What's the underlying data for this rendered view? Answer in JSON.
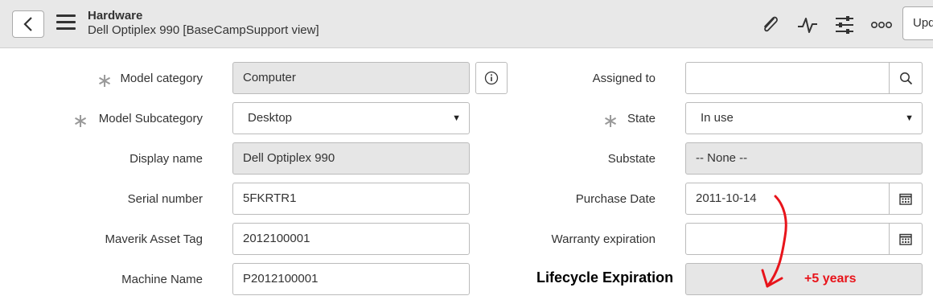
{
  "header": {
    "title": "Hardware",
    "subtitle": "Dell Optiplex 990 [BaseCampSupport view]",
    "update_label": "Upd"
  },
  "form": {
    "model_category": {
      "label": "Model category",
      "value": "Computer"
    },
    "model_subcategory": {
      "label": "Model Subcategory",
      "value": "Desktop"
    },
    "display_name": {
      "label": "Display name",
      "value": "Dell Optiplex 990"
    },
    "serial_number": {
      "label": "Serial number",
      "value": "5FKRTR1"
    },
    "asset_tag": {
      "label": "Maverik Asset Tag",
      "value": "2012100001"
    },
    "machine_name": {
      "label": "Machine Name",
      "value": "P2012100001"
    },
    "assigned_to": {
      "label": "Assigned to",
      "value": ""
    },
    "state": {
      "label": "State",
      "value": "In use"
    },
    "substate": {
      "label": "Substate",
      "value": "-- None --"
    },
    "purchase_date": {
      "label": "Purchase Date",
      "value": "2011-10-14"
    },
    "warranty_expiration": {
      "label": "Warranty expiration",
      "value": ""
    }
  },
  "annotation": {
    "label": "Lifecycle Expiration",
    "note": "+5 years",
    "color": "#e8141b"
  },
  "colors": {
    "header_bg": "#e8e8e8",
    "readonly_bg": "#e6e6e6",
    "required_mark": "#999999"
  }
}
